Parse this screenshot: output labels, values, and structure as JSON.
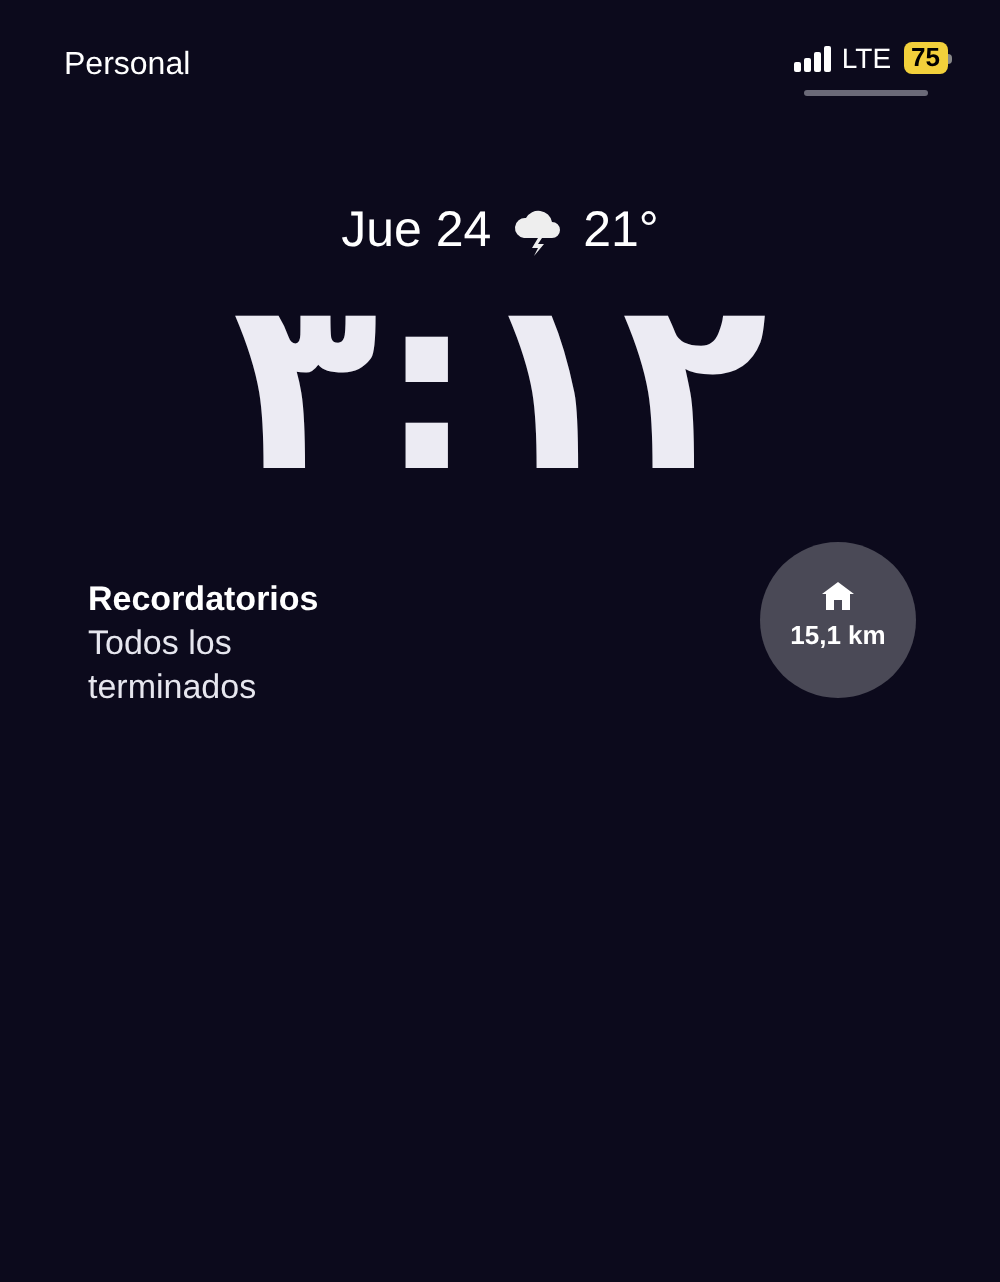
{
  "status_bar": {
    "carrier": "Personal",
    "network": "LTE",
    "battery": "75"
  },
  "lock_screen": {
    "date": "Jue 24",
    "temperature": "21°",
    "time": "٣:١٢"
  },
  "widgets": [
    {
      "kind": "text",
      "title": "Recordatorios",
      "body": "Todos los terminados"
    },
    {
      "kind": "circle",
      "value": "15,1 km"
    }
  ]
}
